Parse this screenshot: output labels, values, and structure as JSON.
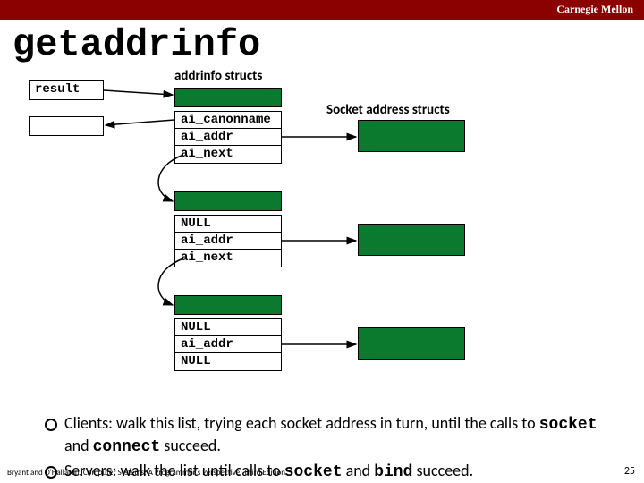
{
  "header": {
    "org": "Carnegie Mellon"
  },
  "title": "getaddrinfo",
  "labels": {
    "result": "result",
    "addrinfo_structs": "addrinfo structs",
    "socket_addr_structs": "Socket address structs"
  },
  "nodes": {
    "n1": {
      "r1": "ai_canonname",
      "r2": "ai_addr",
      "r3": "ai_next"
    },
    "n2": {
      "r1": "NULL",
      "r2": "ai_addr",
      "r3": "ai_next"
    },
    "n3": {
      "r1": "NULL",
      "r2": "ai_addr",
      "r3": "NULL"
    }
  },
  "bullets": {
    "b1_pre": "Clients: walk this list, trying each socket address in turn, until the calls to ",
    "b1_c1": "socket",
    "b1_mid": " and ",
    "b1_c2": "connect",
    "b1_post": " succeed.",
    "b2_pre": "Servers: walk the list until calls to ",
    "b2_c1": "socket",
    "b2_mid": " and ",
    "b2_c2": "bind",
    "b2_post": " succeed."
  },
  "footer": "Bryant and O'Hallaron, Computer Systems: A Programmer's Perspective, Third Edition",
  "page": "25"
}
